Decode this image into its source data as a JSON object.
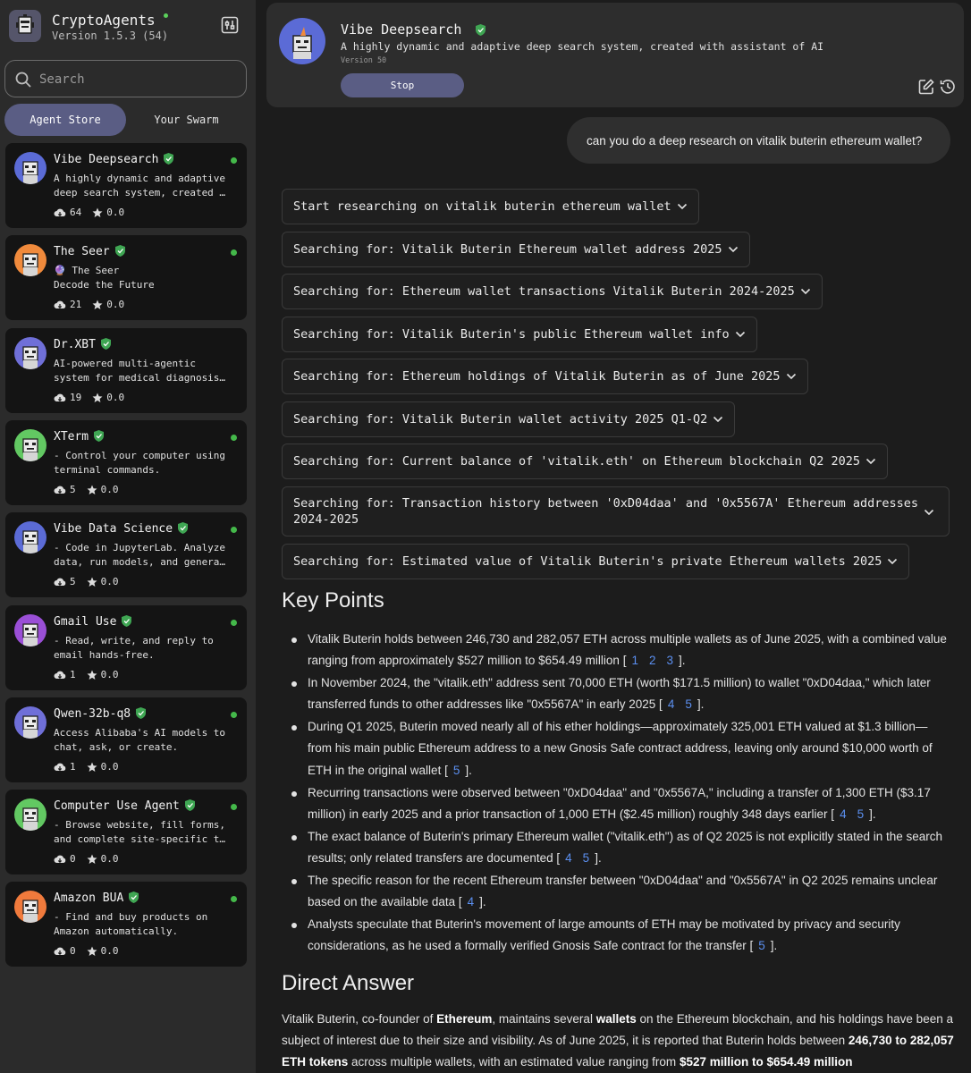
{
  "app": {
    "title": "CryptoAgents",
    "version": "Version 1.5.3 (54)"
  },
  "search": {
    "placeholder": "Search"
  },
  "tabs": {
    "store": "Agent Store",
    "swarm": "Your Swarm"
  },
  "agents": [
    {
      "name": "Vibe Deepsearch",
      "desc1": "A highly dynamic and adaptive",
      "desc2": "deep search system, created …",
      "downloads": "64",
      "rating": "0.0",
      "online": true,
      "color": "#5b6bd6"
    },
    {
      "name": "The Seer",
      "desc1": "🔮 The Seer",
      "desc2": "Decode the Future",
      "downloads": "21",
      "rating": "0.0",
      "online": true,
      "color": "#f08a3c"
    },
    {
      "name": "Dr.XBT",
      "desc1": "AI-powered multi-agentic",
      "desc2": "system for medical diagnosis…",
      "downloads": "19",
      "rating": "0.0",
      "online": false,
      "color": "#6f6fd8"
    },
    {
      "name": "XTerm",
      "desc1": "- Control your computer using",
      "desc2": "terminal commands.",
      "downloads": "5",
      "rating": "0.0",
      "online": true,
      "color": "#62c862"
    },
    {
      "name": "Vibe Data Science",
      "desc1": "- Code in JupyterLab. Analyze",
      "desc2": "data, run models, and genera…",
      "downloads": "5",
      "rating": "0.0",
      "online": true,
      "color": "#5b6bd6"
    },
    {
      "name": "Gmail Use",
      "desc1": "- Read, write, and reply to",
      "desc2": "email hands-free.",
      "downloads": "1",
      "rating": "0.0",
      "online": true,
      "color": "#9a4fd6"
    },
    {
      "name": "Qwen-32b-q8",
      "desc1": "Access Alibaba's AI models to",
      "desc2": "chat, ask, or create.",
      "downloads": "1",
      "rating": "0.0",
      "online": true,
      "color": "#6f6fd8"
    },
    {
      "name": "Computer Use Agent",
      "desc1": "- Browse website, fill forms,",
      "desc2": "and complete site-specific t…",
      "downloads": "0",
      "rating": "0.0",
      "online": true,
      "color": "#62c862"
    },
    {
      "name": "Amazon BUA",
      "desc1": "- Find and buy products on",
      "desc2": "Amazon automatically.",
      "downloads": "0",
      "rating": "0.0",
      "online": true,
      "color": "#f07a3c"
    }
  ],
  "header": {
    "name": "Vibe Deepsearch",
    "desc": "A highly dynamic and adaptive deep search system, created with assistant of AI",
    "version": "Version 50",
    "stop": "Stop"
  },
  "chat": {
    "user_message": "can you do a deep research on vitalik buterin ethereum wallet?",
    "steps": [
      "Start researching on vitalik buterin ethereum wallet",
      "Searching for: Vitalik Buterin Ethereum wallet address 2025",
      "Searching for: Ethereum wallet transactions Vitalik Buterin 2024-2025",
      "Searching for: Vitalik Buterin's public Ethereum wallet info",
      "Searching for: Ethereum holdings of Vitalik Buterin as of June 2025",
      "Searching for: Vitalik Buterin wallet activity 2025 Q1-Q2",
      "Searching for: Current balance of 'vitalik.eth' on Ethereum blockchain Q2 2025",
      "Searching for: Transaction history between '0xD04daa' and '0x5567A' Ethereum addresses 2024-2025",
      "Searching for: Estimated value of Vitalik Buterin's private Ethereum wallets 2025"
    ],
    "key_points_title": "Key Points",
    "key_points": [
      {
        "text": "Vitalik Buterin holds between 246,730 and 282,057 ETH across multiple wallets as of June 2025, with a combined value ranging from approximately $527 million to $654.49 million [",
        "cites": [
          "1",
          "2",
          "3"
        ]
      },
      {
        "text": "In November 2024, the \"vitalik.eth\" address sent 70,000 ETH (worth $171.5 million) to wallet \"0xD04daa,\" which later transferred funds to other addresses like \"0x5567A\" in early 2025 [",
        "cites": [
          "4",
          "5"
        ]
      },
      {
        "text": "During Q1 2025, Buterin moved nearly all of his ether holdings—approximately 325,001 ETH valued at $1.3 billion—from his main public Ethereum address to a new Gnosis Safe contract address, leaving only around $10,000 worth of ETH in the original wallet [",
        "cites": [
          "5"
        ]
      },
      {
        "text": "Recurring transactions were observed between \"0xD04daa\" and \"0x5567A,\" including a transfer of 1,300 ETH ($3.17 million) in early 2025 and a prior transaction of 1,000 ETH ($2.45 million) roughly 348 days earlier [",
        "cites": [
          "4",
          "5"
        ]
      },
      {
        "text": "The exact balance of Buterin's primary Ethereum wallet (\"vitalik.eth\") as of Q2 2025 is not explicitly stated in the search results; only related transfers are documented [",
        "cites": [
          "4",
          "5"
        ]
      },
      {
        "text": "The specific reason for the recent Ethereum transfer between \"0xD04daa\" and \"0x5567A\" in Q2 2025 remains unclear based on the available data [",
        "cites": [
          "4"
        ]
      },
      {
        "text": "Analysts speculate that Buterin's movement of large amounts of ETH may be motivated by privacy and security considerations, as he used a formally verified Gnosis Safe contract for the transfer [",
        "cites": [
          "5"
        ]
      }
    ],
    "direct_answer_title": "Direct Answer",
    "direct_answer": {
      "p1": "Vitalik Buterin, co-founder of ",
      "b1": "Ethereum",
      "p2": ", maintains several ",
      "b2": "wallets",
      "p3": " on the Ethereum blockchain, and his holdings have been a subject of interest due to their size and visibility. As of June 2025, it is reported that Buterin holds between ",
      "b3": "246,730 to 282,057 ETH tokens",
      "p4": " across multiple wallets, with an estimated value ranging from ",
      "b4": "$527 million to $654.49 million",
      "p5": ""
    }
  },
  "colors": {
    "accent": "#5a5d84",
    "online": "#44b84a",
    "verified": "#3fa653",
    "link": "#5b8ff0"
  }
}
